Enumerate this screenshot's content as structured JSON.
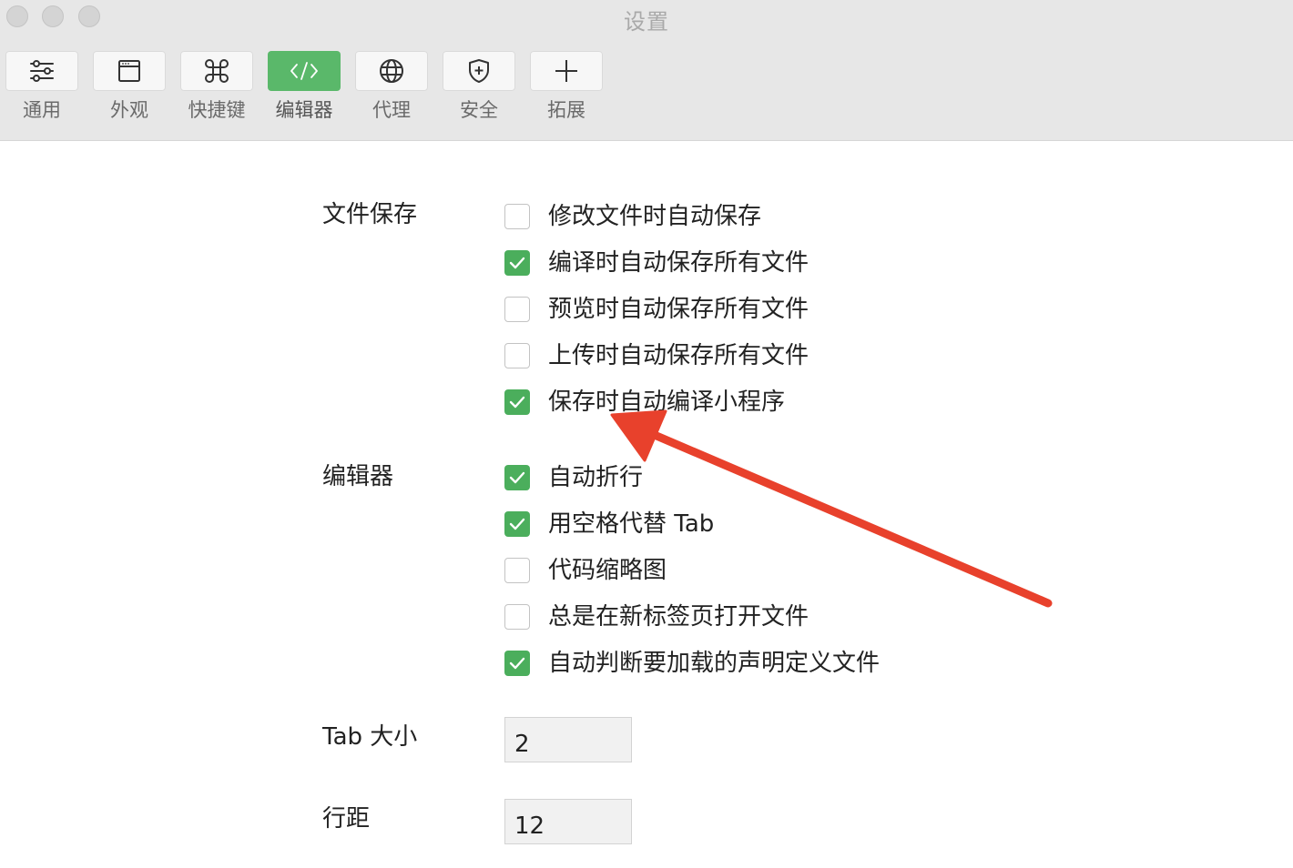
{
  "window": {
    "title": "设置"
  },
  "toolbar": {
    "items": [
      {
        "label": "通用",
        "icon": "sliders-icon",
        "active": false
      },
      {
        "label": "外观",
        "icon": "window-icon",
        "active": false
      },
      {
        "label": "快捷键",
        "icon": "command-icon",
        "active": false
      },
      {
        "label": "编辑器",
        "icon": "code-icon",
        "active": true
      },
      {
        "label": "代理",
        "icon": "globe-icon",
        "active": false
      },
      {
        "label": "安全",
        "icon": "shield-icon",
        "active": false
      },
      {
        "label": "拓展",
        "icon": "plus-icon",
        "active": false
      }
    ]
  },
  "file_save": {
    "label": "文件保存",
    "options": [
      {
        "label": "修改文件时自动保存",
        "checked": false
      },
      {
        "label": "编译时自动保存所有文件",
        "checked": true
      },
      {
        "label": "预览时自动保存所有文件",
        "checked": false
      },
      {
        "label": "上传时自动保存所有文件",
        "checked": false
      },
      {
        "label": "保存时自动编译小程序",
        "checked": true
      }
    ]
  },
  "editor": {
    "label": "编辑器",
    "options": [
      {
        "label": "自动折行",
        "checked": true
      },
      {
        "label": "用空格代替 Tab",
        "checked": true
      },
      {
        "label": "代码缩略图",
        "checked": false
      },
      {
        "label": "总是在新标签页打开文件",
        "checked": false
      },
      {
        "label": "自动判断要加载的声明定义文件",
        "checked": true
      }
    ]
  },
  "tab_size": {
    "label": "Tab 大小",
    "value": "2"
  },
  "line_height": {
    "label": "行距",
    "value": "12"
  },
  "colors": {
    "accent_green": "#4bae5c",
    "active_tab_green": "#5ab86a",
    "annotation_arrow": "#e8412c"
  }
}
